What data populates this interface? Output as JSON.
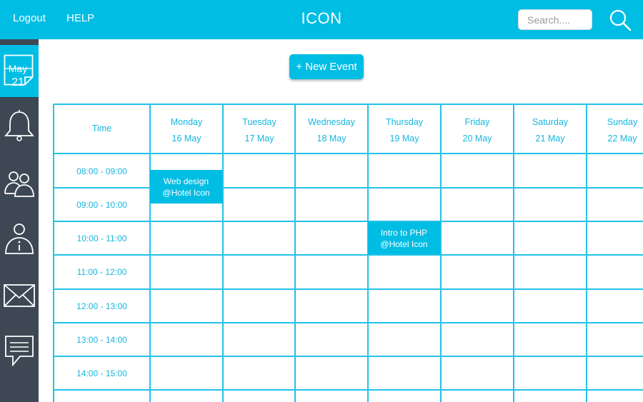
{
  "header": {
    "logout_label": "Logout",
    "help_label": "HELP",
    "title": "ICON",
    "search_placeholder": "Search...."
  },
  "sidebar": {
    "calendar_month": "May",
    "calendar_day": "21",
    "items": [
      "calendar-icon",
      "bell-icon",
      "users-icon",
      "user-info-icon",
      "mail-icon",
      "chat-icon"
    ]
  },
  "toolbar": {
    "new_event_label": "+ New Event"
  },
  "calendar": {
    "time_header": "Time",
    "days": [
      {
        "name": "Monday",
        "date": "16 May"
      },
      {
        "name": "Tuesday",
        "date": "17 May"
      },
      {
        "name": "Wednesday",
        "date": "18 May"
      },
      {
        "name": "Thursday",
        "date": "19 May"
      },
      {
        "name": "Friday",
        "date": "20 May"
      },
      {
        "name": "Saturday",
        "date": "21 May"
      },
      {
        "name": "Sunday",
        "date": "22 May"
      }
    ],
    "times": [
      "08:00 - 09:00",
      "09:00 - 10:00",
      "10:00 - 11:00",
      "11:00 - 12:00",
      "12:00 - 13:00",
      "13:00 - 14:00",
      "14:00 - 15:00"
    ],
    "events": [
      {
        "title": "Web design",
        "location": "@Hotel Icon",
        "day": "Monday",
        "start": "08:30",
        "end": "09:30"
      },
      {
        "title": "Intro to PHP",
        "location": "@Hotel Icon",
        "day": "Thursday",
        "start": "10:00",
        "end": "11:00"
      }
    ]
  },
  "colors": {
    "accent": "#00bde4",
    "grid_line": "#22c2e8",
    "sidebar": "#3d4854",
    "text_accent": "#17b6df"
  }
}
